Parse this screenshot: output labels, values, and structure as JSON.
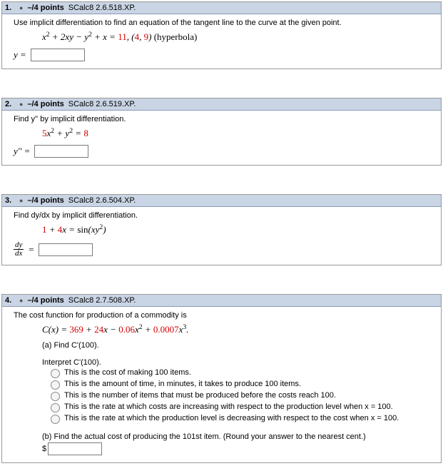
{
  "questions": [
    {
      "num": "1.",
      "points": "–/4 points",
      "ref": "SCalc8 2.6.518.XP.",
      "prompt": "Use implicit differentiation to find an equation of the tangent line to the curve at the given point.",
      "equation_html": "x<sup>2</sup> + 2xy − y<sup>2</sup> + x = <span class='red'>11</span>,  (<span class='red'>4</span>, <span class='red'>9</span>)  <span class='nonitalic'>(hyperbola)</span>",
      "answer_label": "y ="
    },
    {
      "num": "2.",
      "points": "–/4 points",
      "ref": "SCalc8 2.6.519.XP.",
      "prompt": "Find  y''  by implicit differentiation.",
      "equation_html": "<span class='red'>5</span>x<sup>2</sup> + y<sup>2</sup> = <span class='red'>8</span>",
      "answer_label": "y'' ="
    },
    {
      "num": "3.",
      "points": "–/4 points",
      "ref": "SCalc8 2.6.504.XP.",
      "prompt": "Find dy/dx by implicit differentiation.",
      "equation_html": "<span class='red'>1</span> + <span class='red'>4</span>x = <span class='nonitalic'>sin</span>(xy<sup>2</sup>)",
      "answer_frac": {
        "num": "dy",
        "den": "dx"
      }
    },
    {
      "num": "4.",
      "points": "–/4 points",
      "ref": "SCalc8 2.7.508.XP.",
      "prompt": "The cost function for production of a commodity is",
      "cost_eq_html": "C(x) = <span class='red'>369</span> + <span class='red'>24</span>x − <span class='red'>0.06</span>x<sup>2</sup> + <span class='red'>0.0007</span>x<sup>3</sup>.",
      "part_a": "(a) Find C'(100).",
      "interpret_label": "Interpret  C'(100).",
      "options": [
        "This is the cost of making 100 items.",
        "This is the amount of time, in minutes, it takes to produce 100 items.",
        "This is the number of items that must be produced before the costs reach 100.",
        "This is the rate at which costs are increasing with respect to the production level when x = 100.",
        "This is the rate at which the production level is decreasing with respect to the cost when x = 100."
      ],
      "part_b": "(b) Find the actual cost of producing the 101st item. (Round your answer to the nearest cent.)",
      "currency": "$"
    }
  ],
  "chart_data": {
    "type": "table",
    "title": "Homework problems — SCalc8 §2.6–2.7",
    "rows": [
      {
        "q": 1,
        "points_possible": 4,
        "ref": "SCalc8 2.6.518.XP",
        "equation": "x^2 + 2xy - y^2 + x = 11",
        "point": [
          4,
          9
        ]
      },
      {
        "q": 2,
        "points_possible": 4,
        "ref": "SCalc8 2.6.519.XP",
        "equation": "5x^2 + y^2 = 8"
      },
      {
        "q": 3,
        "points_possible": 4,
        "ref": "SCalc8 2.6.504.XP",
        "equation": "1 + 4x = sin(xy^2)"
      },
      {
        "q": 4,
        "points_possible": 4,
        "ref": "SCalc8 2.7.508.XP",
        "equation": "C(x) = 369 + 24x - 0.06x^2 + 0.0007x^3"
      }
    ]
  }
}
